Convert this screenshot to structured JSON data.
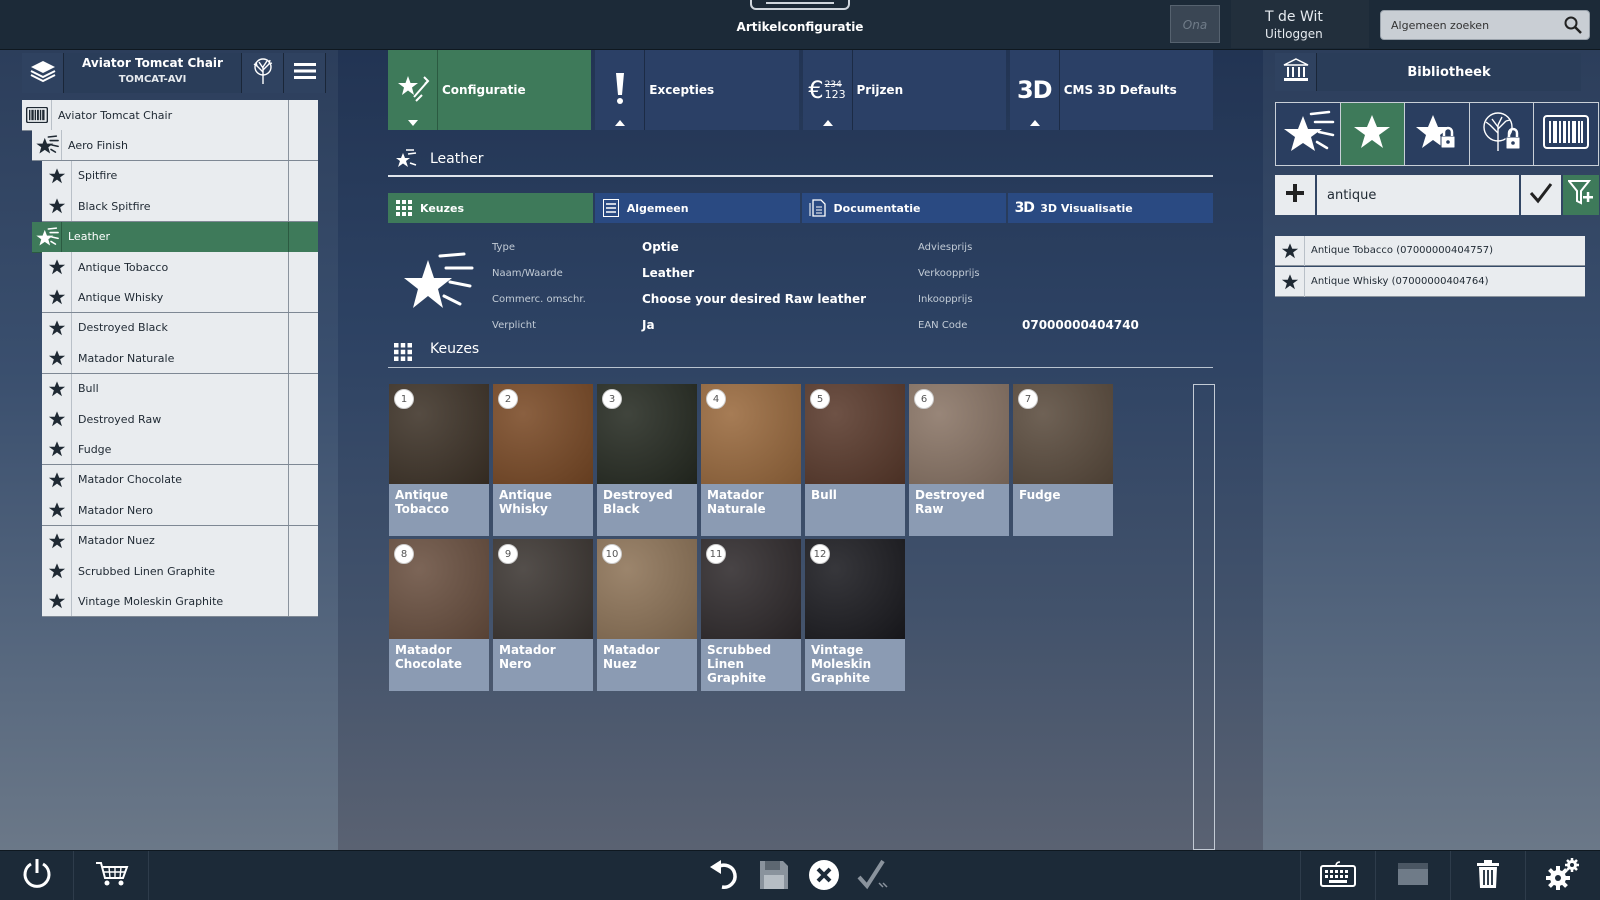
{
  "topbar": {
    "title": "Artikelconfiguratie",
    "ona_label": "Ona",
    "user_name": "T de Wit",
    "logout_label": "Uitloggen",
    "search_placeholder": "Algemeen zoeken"
  },
  "left": {
    "product_name": "Aviator Tomcat Chair",
    "product_code": "TOMCAT-AVI",
    "tree": [
      {
        "label": "Aviator Tomcat Chair",
        "icon": "barcode-icon",
        "level": 0
      },
      {
        "label": "Aero Finish",
        "icon": "stars-icon",
        "level": 1
      },
      {
        "label": "Spitfire",
        "icon": "star-icon",
        "level": 2
      },
      {
        "label": "Black Spitfire",
        "icon": "star-icon",
        "level": 2
      },
      {
        "label": "Leather",
        "icon": "stars-icon",
        "level": 1,
        "selected": true
      },
      {
        "label": "Antique Tobacco",
        "icon": "star-icon",
        "level": 2
      },
      {
        "label": "Antique Whisky",
        "icon": "star-icon",
        "level": 2
      },
      {
        "label": "Destroyed Black",
        "icon": "star-icon",
        "level": 2
      },
      {
        "label": "Matador Naturale",
        "icon": "star-icon",
        "level": 2
      },
      {
        "label": "Bull",
        "icon": "star-icon",
        "level": 2
      },
      {
        "label": "Destroyed Raw",
        "icon": "star-icon",
        "level": 2
      },
      {
        "label": "Fudge",
        "icon": "star-icon",
        "level": 2
      },
      {
        "label": "Matador Chocolate",
        "icon": "star-icon",
        "level": 2
      },
      {
        "label": "Matador Nero",
        "icon": "star-icon",
        "level": 2
      },
      {
        "label": "Matador Nuez",
        "icon": "star-icon",
        "level": 2
      },
      {
        "label": "Scrubbed Linen Graphite",
        "icon": "star-icon",
        "level": 2
      },
      {
        "label": "Vintage Moleskin Graphite",
        "icon": "star-icon",
        "level": 2
      }
    ]
  },
  "main": {
    "tabs": [
      {
        "label": "Configuratie",
        "icon": "config-icon",
        "active": true
      },
      {
        "label": "Excepties",
        "icon": "exclamation-icon"
      },
      {
        "label": "Prijzen",
        "icon": "euro-icon",
        "icon_small": "234",
        "icon_small2": "123"
      },
      {
        "label": "CMS 3D Defaults",
        "icon": "3d-icon",
        "icon_text": "3D"
      }
    ],
    "section_title": "Leather",
    "subtabs": [
      {
        "label": "Keuzes",
        "icon": "grid-icon",
        "active": true
      },
      {
        "label": "Algemeen",
        "icon": "list-icon"
      },
      {
        "label": "Documentatie",
        "icon": "document-icon"
      },
      {
        "label": "3D Visualisatie",
        "icon": "3d-icon",
        "icon_text": "3D"
      }
    ],
    "details": {
      "type_label": "Type",
      "type_value": "Optie",
      "name_label": "Naam/Waarde",
      "name_value": "Leather",
      "desc_label": "Commerc. omschr.",
      "desc_value": "Choose your desired Raw leather",
      "req_label": "Verplicht",
      "req_value": "Ja",
      "advice_label": "Adviesprijs",
      "sale_label": "Verkoopprijs",
      "purchase_label": "Inkoopprijs",
      "ean_label": "EAN Code",
      "ean_value": "07000000404740"
    },
    "choices_title": "Keuzes",
    "choices": [
      {
        "num": "1",
        "name": "Antique Tobacco",
        "color": "#3e3328"
      },
      {
        "num": "2",
        "name": "Antique Whisky",
        "color": "#7a4a26"
      },
      {
        "num": "3",
        "name": "Destroyed Black",
        "color": "#262b22"
      },
      {
        "num": "4",
        "name": "Matador Naturale",
        "color": "#9a6a3e"
      },
      {
        "num": "5",
        "name": "Bull",
        "color": "#5a3a2c"
      },
      {
        "num": "6",
        "name": "Destroyed Raw",
        "color": "#8a7566"
      },
      {
        "num": "7",
        "name": "Fudge",
        "color": "#5b4c3e"
      },
      {
        "num": "8",
        "name": "Matador Chocolate",
        "color": "#6a5040"
      },
      {
        "num": "9",
        "name": "Matador Nero",
        "color": "#3c3632"
      },
      {
        "num": "10",
        "name": "Matador Nuez",
        "color": "#8e7458"
      },
      {
        "num": "11",
        "name": "Scrubbed Linen Graphite",
        "color": "#2f2a2c"
      },
      {
        "num": "12",
        "name": "Vintage Moleskin Graphite",
        "color": "#1b1b20"
      }
    ]
  },
  "right": {
    "title": "Bibliotheek",
    "search_value": "antique",
    "results": [
      {
        "label": "Antique Tobacco (07000000404757)"
      },
      {
        "label": "Antique Whisky (07000000404764)"
      }
    ]
  },
  "colors": {
    "accent_green": "#3e7a5a",
    "tab_blue": "#2a4a82",
    "bar_dark": "#1c2a38"
  }
}
